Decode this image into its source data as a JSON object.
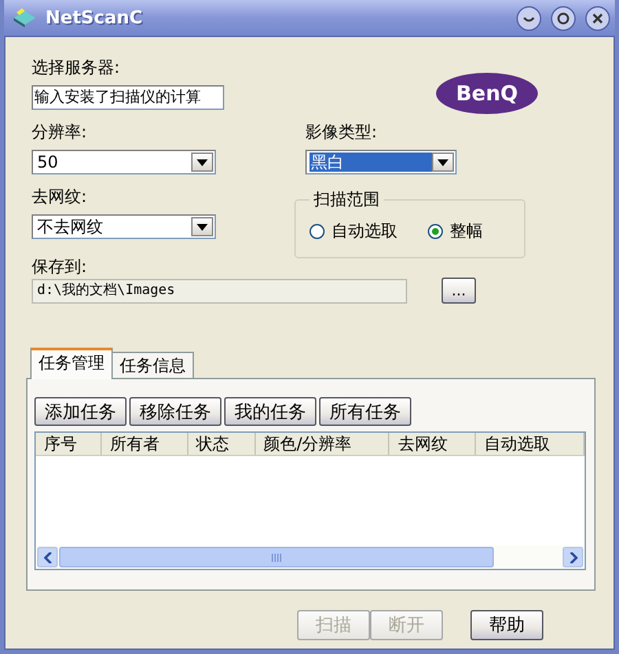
{
  "window": {
    "title": "NetScanC"
  },
  "server": {
    "label": "选择服务器:",
    "value": "输入安装了扫描仪的计算"
  },
  "logo": {
    "text": "BenQ"
  },
  "resolution": {
    "label": "分辨率:",
    "value": "50"
  },
  "image_type": {
    "label": "影像类型:",
    "value": "黑白",
    "focused": true
  },
  "descreen": {
    "label": "去网纹:",
    "value": "不去网纹"
  },
  "scan_range": {
    "title": "扫描范围",
    "options": [
      {
        "label": "自动选取",
        "selected": false
      },
      {
        "label": "整幅",
        "selected": true
      }
    ]
  },
  "save_to": {
    "label": "保存到:",
    "value": "d:\\我的文档\\Images",
    "browse": "..."
  },
  "tabs": [
    {
      "label": "任务管理",
      "selected": true
    },
    {
      "label": "任务信息",
      "selected": false
    }
  ],
  "task_buttons": [
    "添加任务",
    "移除任务",
    "我的任务",
    "所有任务"
  ],
  "table": {
    "columns": [
      "序号",
      "所有者",
      "状态",
      "颜色/分辨率",
      "去网纹",
      "自动选取"
    ]
  },
  "buttons": [
    {
      "label": "扫描",
      "disabled": true
    },
    {
      "label": "断开",
      "disabled": true
    },
    {
      "label": "帮助",
      "disabled": false
    }
  ]
}
